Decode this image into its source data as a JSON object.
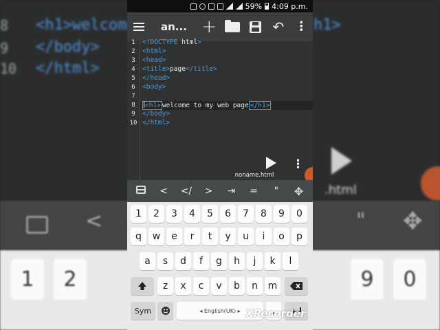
{
  "status_bar": {
    "battery": "59%",
    "time": "4:09 p.m."
  },
  "app_bar": {
    "title": "an...",
    "icons": [
      "menu-icon",
      "plus-icon",
      "folder-open-icon",
      "save-icon",
      "undo-icon",
      "more-vert-icon"
    ]
  },
  "editor": {
    "line_numbers": [
      "1",
      "2",
      "3",
      "4",
      "5",
      "6",
      "7",
      "8",
      "9",
      "10"
    ],
    "lines": [
      {
        "a": "<!DOCTYPE ",
        "b": "html",
        "c": ">"
      },
      {
        "a": "<html>"
      },
      {
        "a": "<head>"
      },
      {
        "a": "<title>",
        "b": "page",
        "c": "</title>"
      },
      {
        "a": "</head>"
      },
      {
        "a": "<body>"
      },
      {
        "a": ""
      },
      {
        "a": "<h1>",
        "b": "welcome to my web page",
        "c": "</h1>"
      },
      {
        "a": "</body>"
      },
      {
        "a": "</html>"
      }
    ],
    "filename": "noname.html"
  },
  "symbol_bar": [
    "<",
    "</",
    ">",
    "⇥",
    "=",
    "\""
  ],
  "keyboard": {
    "row_numbers": [
      "1",
      "2",
      "3",
      "4",
      "5",
      "6",
      "7",
      "8",
      "9",
      "0"
    ],
    "row1": [
      "q",
      "w",
      "e",
      "r",
      "t",
      "y",
      "u",
      "i",
      "o",
      "p"
    ],
    "row2": [
      "a",
      "s",
      "d",
      "f",
      "g",
      "h",
      "j",
      "k",
      "l"
    ],
    "row3": [
      "z",
      "x",
      "c",
      "v",
      "b",
      "n",
      "m"
    ],
    "sym_label": "Sym",
    "language": "◂ English(UK) ▸",
    "comma": ","
  },
  "background": {
    "code_line_1": "<h1>welcome",
    "code_line_2": "</body>",
    "code_line_3": "</html>",
    "line_nums": [
      "8",
      "9",
      "10"
    ],
    "toolbar_syms": [
      "<",
      "\""
    ],
    "file_frag": ".html",
    "keys": [
      "1",
      "2",
      "9",
      "0"
    ],
    "code_right": "h1>"
  },
  "watermark": "XRecorder",
  "colors": {
    "tag": "#4f9ad9",
    "editor_bg": "#303232",
    "appbar_bg": "#3b3d3e",
    "keyboard_bg": "#e8e8e8"
  }
}
